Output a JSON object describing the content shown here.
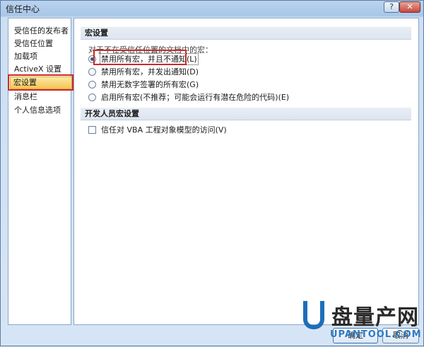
{
  "window": {
    "title": "信任中心",
    "help_label": "?",
    "close_label": "✕"
  },
  "sidebar": {
    "items": [
      {
        "label": "受信任的发布者"
      },
      {
        "label": "受信任位置"
      },
      {
        "label": "加载项"
      },
      {
        "label": "ActiveX 设置"
      },
      {
        "label": "宏设置",
        "selected": true
      },
      {
        "label": "消息栏"
      },
      {
        "label": "个人信息选项"
      }
    ]
  },
  "macro_section": {
    "header": "宏设置",
    "intro": "对于不在受信任位置的文档中的宏：",
    "options": [
      {
        "label": "禁用所有宏，并且不通知(L)",
        "checked": true
      },
      {
        "label": "禁用所有宏，并发出通知(D)",
        "checked": false
      },
      {
        "label": "禁用无数字签署的所有宏(G)",
        "checked": false
      },
      {
        "label": "启用所有宏(不推荐；可能会运行有潜在危险的代码)(E)",
        "checked": false
      }
    ]
  },
  "developer_section": {
    "header": "开发人员宏设置",
    "vba_checkbox_label": "信任对 VBA 工程对象模型的访问(V)",
    "vba_checked": false
  },
  "buttons": {
    "ok": "确定",
    "cancel": "取消"
  },
  "watermark": {
    "title": "盘量产网",
    "url": "UPANTOOL.COM"
  },
  "colors": {
    "highlight_red": "#cc2a2a",
    "selected_nav": "#f4c556",
    "watermark_blue": "#1d6fb8"
  }
}
